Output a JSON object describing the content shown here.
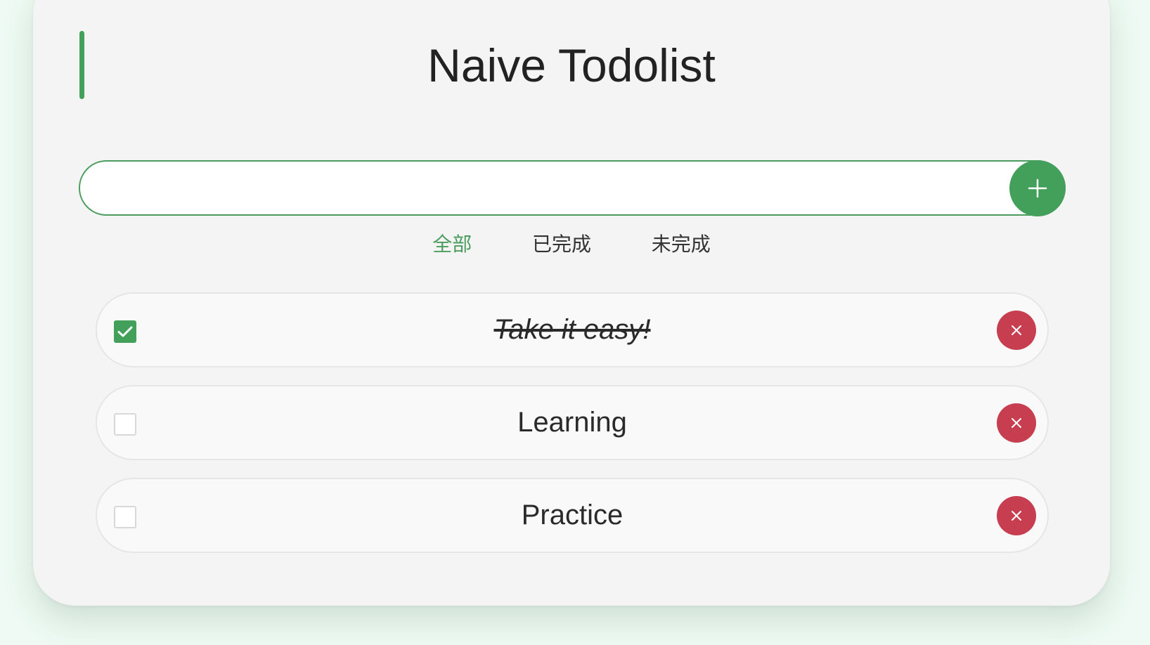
{
  "app": {
    "title": "Naive Todolist"
  },
  "input": {
    "value": "",
    "placeholder": ""
  },
  "add_button": {
    "icon": "plus-icon"
  },
  "filters": [
    {
      "label": "全部",
      "active": true
    },
    {
      "label": "已完成",
      "active": false
    },
    {
      "label": "未完成",
      "active": false
    }
  ],
  "todos": [
    {
      "text": "Take it easy!",
      "done": true
    },
    {
      "text": "Learning",
      "done": false
    },
    {
      "text": "Practice",
      "done": false
    }
  ],
  "colors": {
    "accent": "#43a05b",
    "danger": "#c73e51",
    "card_background": "#f4f4f4",
    "page_background": "#eefaf3"
  },
  "icons": {
    "checkbox_checked": "check-icon",
    "delete": "close-icon"
  }
}
